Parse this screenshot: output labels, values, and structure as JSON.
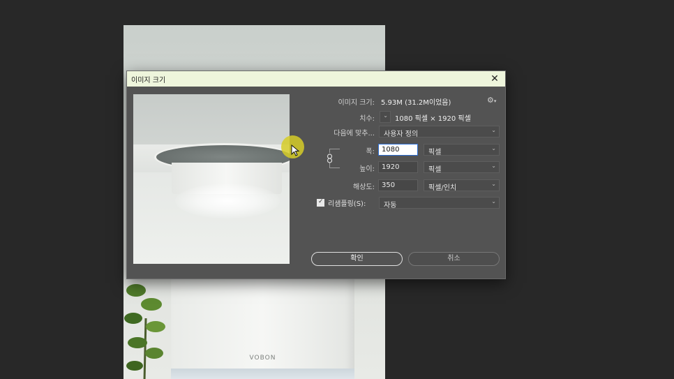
{
  "background": {
    "photo_logo": "VOBON"
  },
  "dialog": {
    "title": "이미지 크기",
    "image_size_label": "이미지 크기:",
    "image_size_value": "5.93M (31.2M이었음)",
    "dimensions_label": "치수:",
    "dimensions_value": "1080 픽셀  ×  1920 픽셀",
    "fit_to_label": "다음에 맞추...",
    "fit_to_value": "사용자 정의",
    "width_label": "폭:",
    "width_value": "1080",
    "width_unit": "픽셀",
    "height_label": "높이:",
    "height_value": "1920",
    "height_unit": "픽셀",
    "resolution_label": "해상도:",
    "resolution_value": "350",
    "resolution_unit": "픽셀/인치",
    "resample_label": "리샘플링(S):",
    "resample_value": "자동",
    "resample_checked": true,
    "ok_label": "확인",
    "cancel_label": "취소"
  },
  "colors": {
    "dialog_bg": "#535353",
    "titlebar_bg": "#eef5dc",
    "cursor_highlight": "#d6cd28"
  }
}
